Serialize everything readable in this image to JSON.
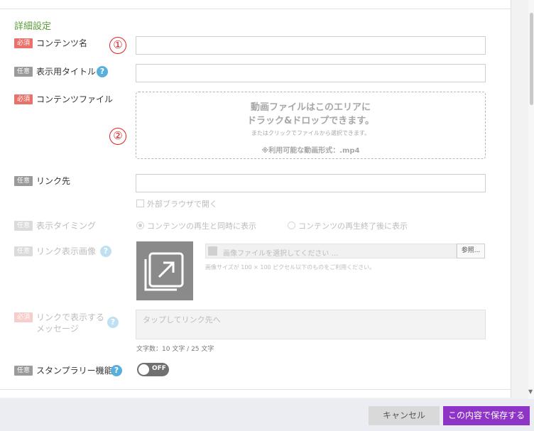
{
  "section_title": "詳細設定",
  "badges": {
    "required": "必須",
    "optional": "任意"
  },
  "annotations": [
    "①",
    "②"
  ],
  "fields": {
    "content_name": {
      "label": "コンテンツ名",
      "value": ""
    },
    "display_title": {
      "label": "表示用タイトル",
      "value": ""
    },
    "content_file": {
      "label": "コンテンツファイル",
      "drop_line1": "動画ファイルはこのエリアに",
      "drop_line2": "ドラック&ドロップできます。",
      "drop_line3": "またはクリックでファイルから選択できます。",
      "drop_line4": "※利用可能な動画形式：.mp4"
    },
    "link": {
      "label": "リンク先",
      "value": "",
      "external_label": "外部ブラウザで開く",
      "external_checked": false
    },
    "display_timing": {
      "label": "表示タイミング",
      "options": [
        "コンテンツの再生と同時に表示",
        "コンテンツの再生終了後に表示"
      ],
      "selected": 0
    },
    "link_image": {
      "label": "リンク表示画像",
      "placeholder": "画像ファイルを選択してください …",
      "browse_label": "参照...",
      "hint": "画像サイズが 100 × 100 ピクセル以下のものをご利用ください。"
    },
    "link_message": {
      "label_line1": "リンクで表示する",
      "label_line2": "メッセージ",
      "placeholder": "タップしてリンク先へ",
      "char_count": "文字数：10 文字 / 25 文字"
    },
    "stamp_rally": {
      "label": "スタンプラリー機能",
      "toggle": "OFF"
    }
  },
  "help_icon": "?",
  "footer": {
    "cancel": "キャンセル",
    "save": "この内容で保存する"
  },
  "colors": {
    "accent": "#8e35c8",
    "required": "#e8726a",
    "optional": "#9a9a9a",
    "section": "#5a9e3b",
    "help": "#5aaedc"
  }
}
